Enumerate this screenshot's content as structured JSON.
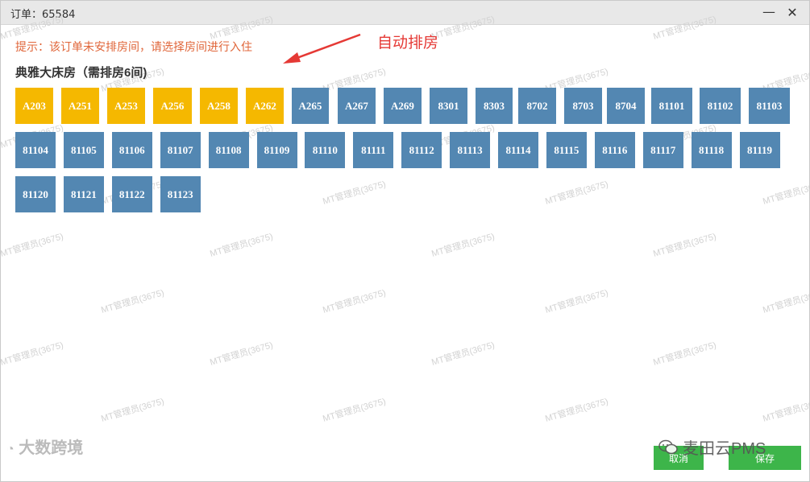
{
  "window": {
    "title": "订单：65584",
    "minimize_glyph": "—",
    "close_glyph": "✕"
  },
  "hint": "提示：该订单未安排房间，请选择房间进行入住",
  "annotation": {
    "text": "自动排房",
    "color": "#e53935"
  },
  "room_type": {
    "title": "典雅大床房（需排房6间)"
  },
  "colors": {
    "free": "#5387b2",
    "assigned": "#f5b800",
    "button": "#3db54a"
  },
  "rooms": [
    {
      "label": "A203",
      "state": "assigned"
    },
    {
      "label": "A251",
      "state": "assigned"
    },
    {
      "label": "A253",
      "state": "assigned"
    },
    {
      "label": "A256",
      "state": "assigned"
    },
    {
      "label": "A258",
      "state": "assigned"
    },
    {
      "label": "A262",
      "state": "assigned"
    },
    {
      "label": "A265",
      "state": "free"
    },
    {
      "label": "A267",
      "state": "free"
    },
    {
      "label": "A269",
      "state": "free"
    },
    {
      "label": "8301",
      "state": "free"
    },
    {
      "label": "8303",
      "state": "free"
    },
    {
      "label": "8702",
      "state": "free"
    },
    {
      "label": "8703",
      "state": "free"
    },
    {
      "label": "8704",
      "state": "free"
    },
    {
      "label": "81101",
      "state": "free"
    },
    {
      "label": "81102",
      "state": "free"
    },
    {
      "label": "81103",
      "state": "free"
    },
    {
      "label": "81104",
      "state": "free"
    },
    {
      "label": "81105",
      "state": "free"
    },
    {
      "label": "81106",
      "state": "free"
    },
    {
      "label": "81107",
      "state": "free"
    },
    {
      "label": "81108",
      "state": "free"
    },
    {
      "label": "81109",
      "state": "free"
    },
    {
      "label": "81110",
      "state": "free"
    },
    {
      "label": "81111",
      "state": "free"
    },
    {
      "label": "81112",
      "state": "free"
    },
    {
      "label": "81113",
      "state": "free"
    },
    {
      "label": "81114",
      "state": "free"
    },
    {
      "label": "81115",
      "state": "free"
    },
    {
      "label": "81116",
      "state": "free"
    },
    {
      "label": "81117",
      "state": "free"
    },
    {
      "label": "81118",
      "state": "free"
    },
    {
      "label": "81119",
      "state": "free"
    },
    {
      "label": "81120",
      "state": "free"
    },
    {
      "label": "81121",
      "state": "free"
    },
    {
      "label": "81122",
      "state": "free"
    },
    {
      "label": "81123",
      "state": "free"
    }
  ],
  "buttons": {
    "cancel": "取消",
    "save": "保存"
  },
  "watermark": {
    "text": "MT管理员(3675)"
  },
  "brand_watermark": {
    "text": "麦田云PMS",
    "icon": "wechat-icon"
  },
  "logo_watermark": {
    "text": "大数跨境",
    "icon": "weibo-icon"
  }
}
